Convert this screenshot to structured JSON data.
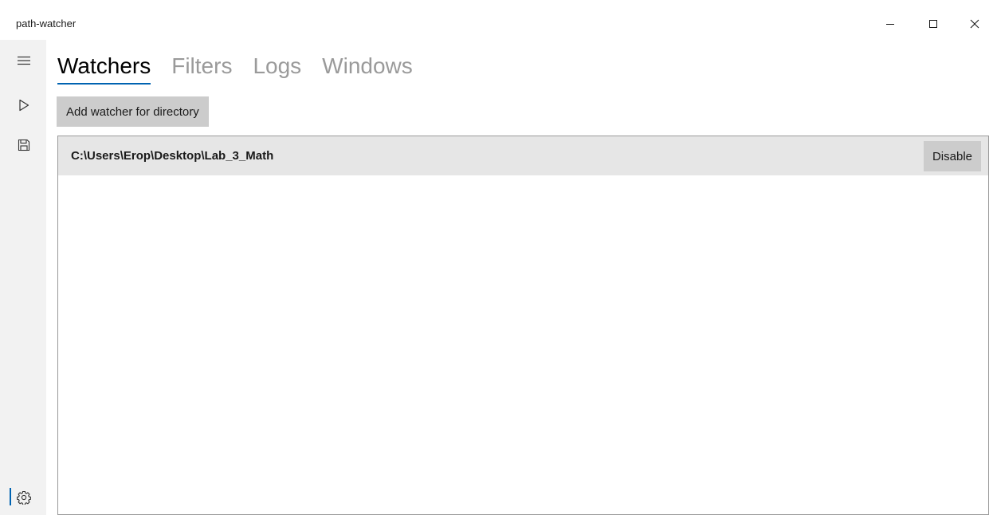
{
  "window": {
    "title": "path-watcher"
  },
  "rail": {
    "items": [
      {
        "icon": "hamburger-menu-icon"
      },
      {
        "icon": "play-icon"
      },
      {
        "icon": "save-icon"
      },
      {
        "icon": "gear-icon",
        "selected": true
      }
    ]
  },
  "tabs": [
    {
      "label": "Watchers",
      "active": true
    },
    {
      "label": "Filters",
      "active": false
    },
    {
      "label": "Logs",
      "active": false
    },
    {
      "label": "Windows",
      "active": false
    }
  ],
  "toolbar": {
    "add_label": "Add watcher for directory"
  },
  "watchers": [
    {
      "path": "C:\\Users\\Erop\\Desktop\\Lab_3_Math",
      "action_label": "Disable"
    }
  ],
  "colors": {
    "accent": "#0063b1",
    "rail_bg": "#f2f2f2",
    "button_bg": "#cccccc",
    "row_bg": "#e6e6e6",
    "inactive_tab": "#9a9a9a"
  }
}
